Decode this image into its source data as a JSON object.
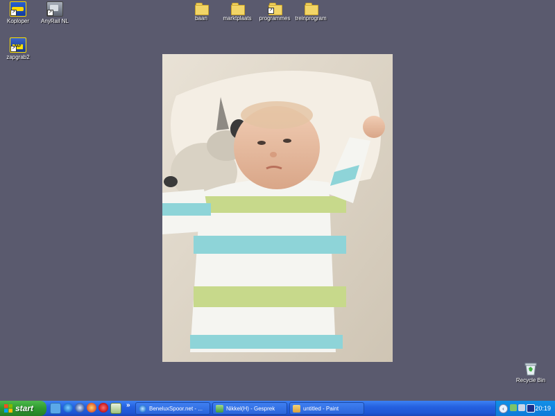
{
  "desktop": {
    "icons": [
      {
        "label": "Koploper",
        "icon": "train-icon"
      },
      {
        "label": "AnyRail NL",
        "icon": "anyrail-icon"
      },
      {
        "label": "zapgrab2",
        "icon": "zapgrab-icon"
      },
      {
        "label": "baan",
        "icon": "folder-icon"
      },
      {
        "label": "marktplaats",
        "icon": "folder-icon"
      },
      {
        "label": "programmes",
        "icon": "folder-shortcut-icon"
      },
      {
        "label": "treinprogram",
        "icon": "folder-icon"
      },
      {
        "label": "Recycle Bin",
        "icon": "recycle-bin-icon"
      }
    ],
    "wallpaper_color": "#5a5a6e"
  },
  "taskbar": {
    "start_label": "start",
    "tasks": [
      {
        "label": "BeneluxSpoor.net - ...",
        "icon": "internet-explorer-icon"
      },
      {
        "label": "Nikkel(H) - Gesprek",
        "icon": "msn-chat-icon"
      },
      {
        "label": "untitled - Paint",
        "icon": "paint-icon"
      }
    ],
    "quick_launch_chevron": "»",
    "clock": "20:19"
  }
}
